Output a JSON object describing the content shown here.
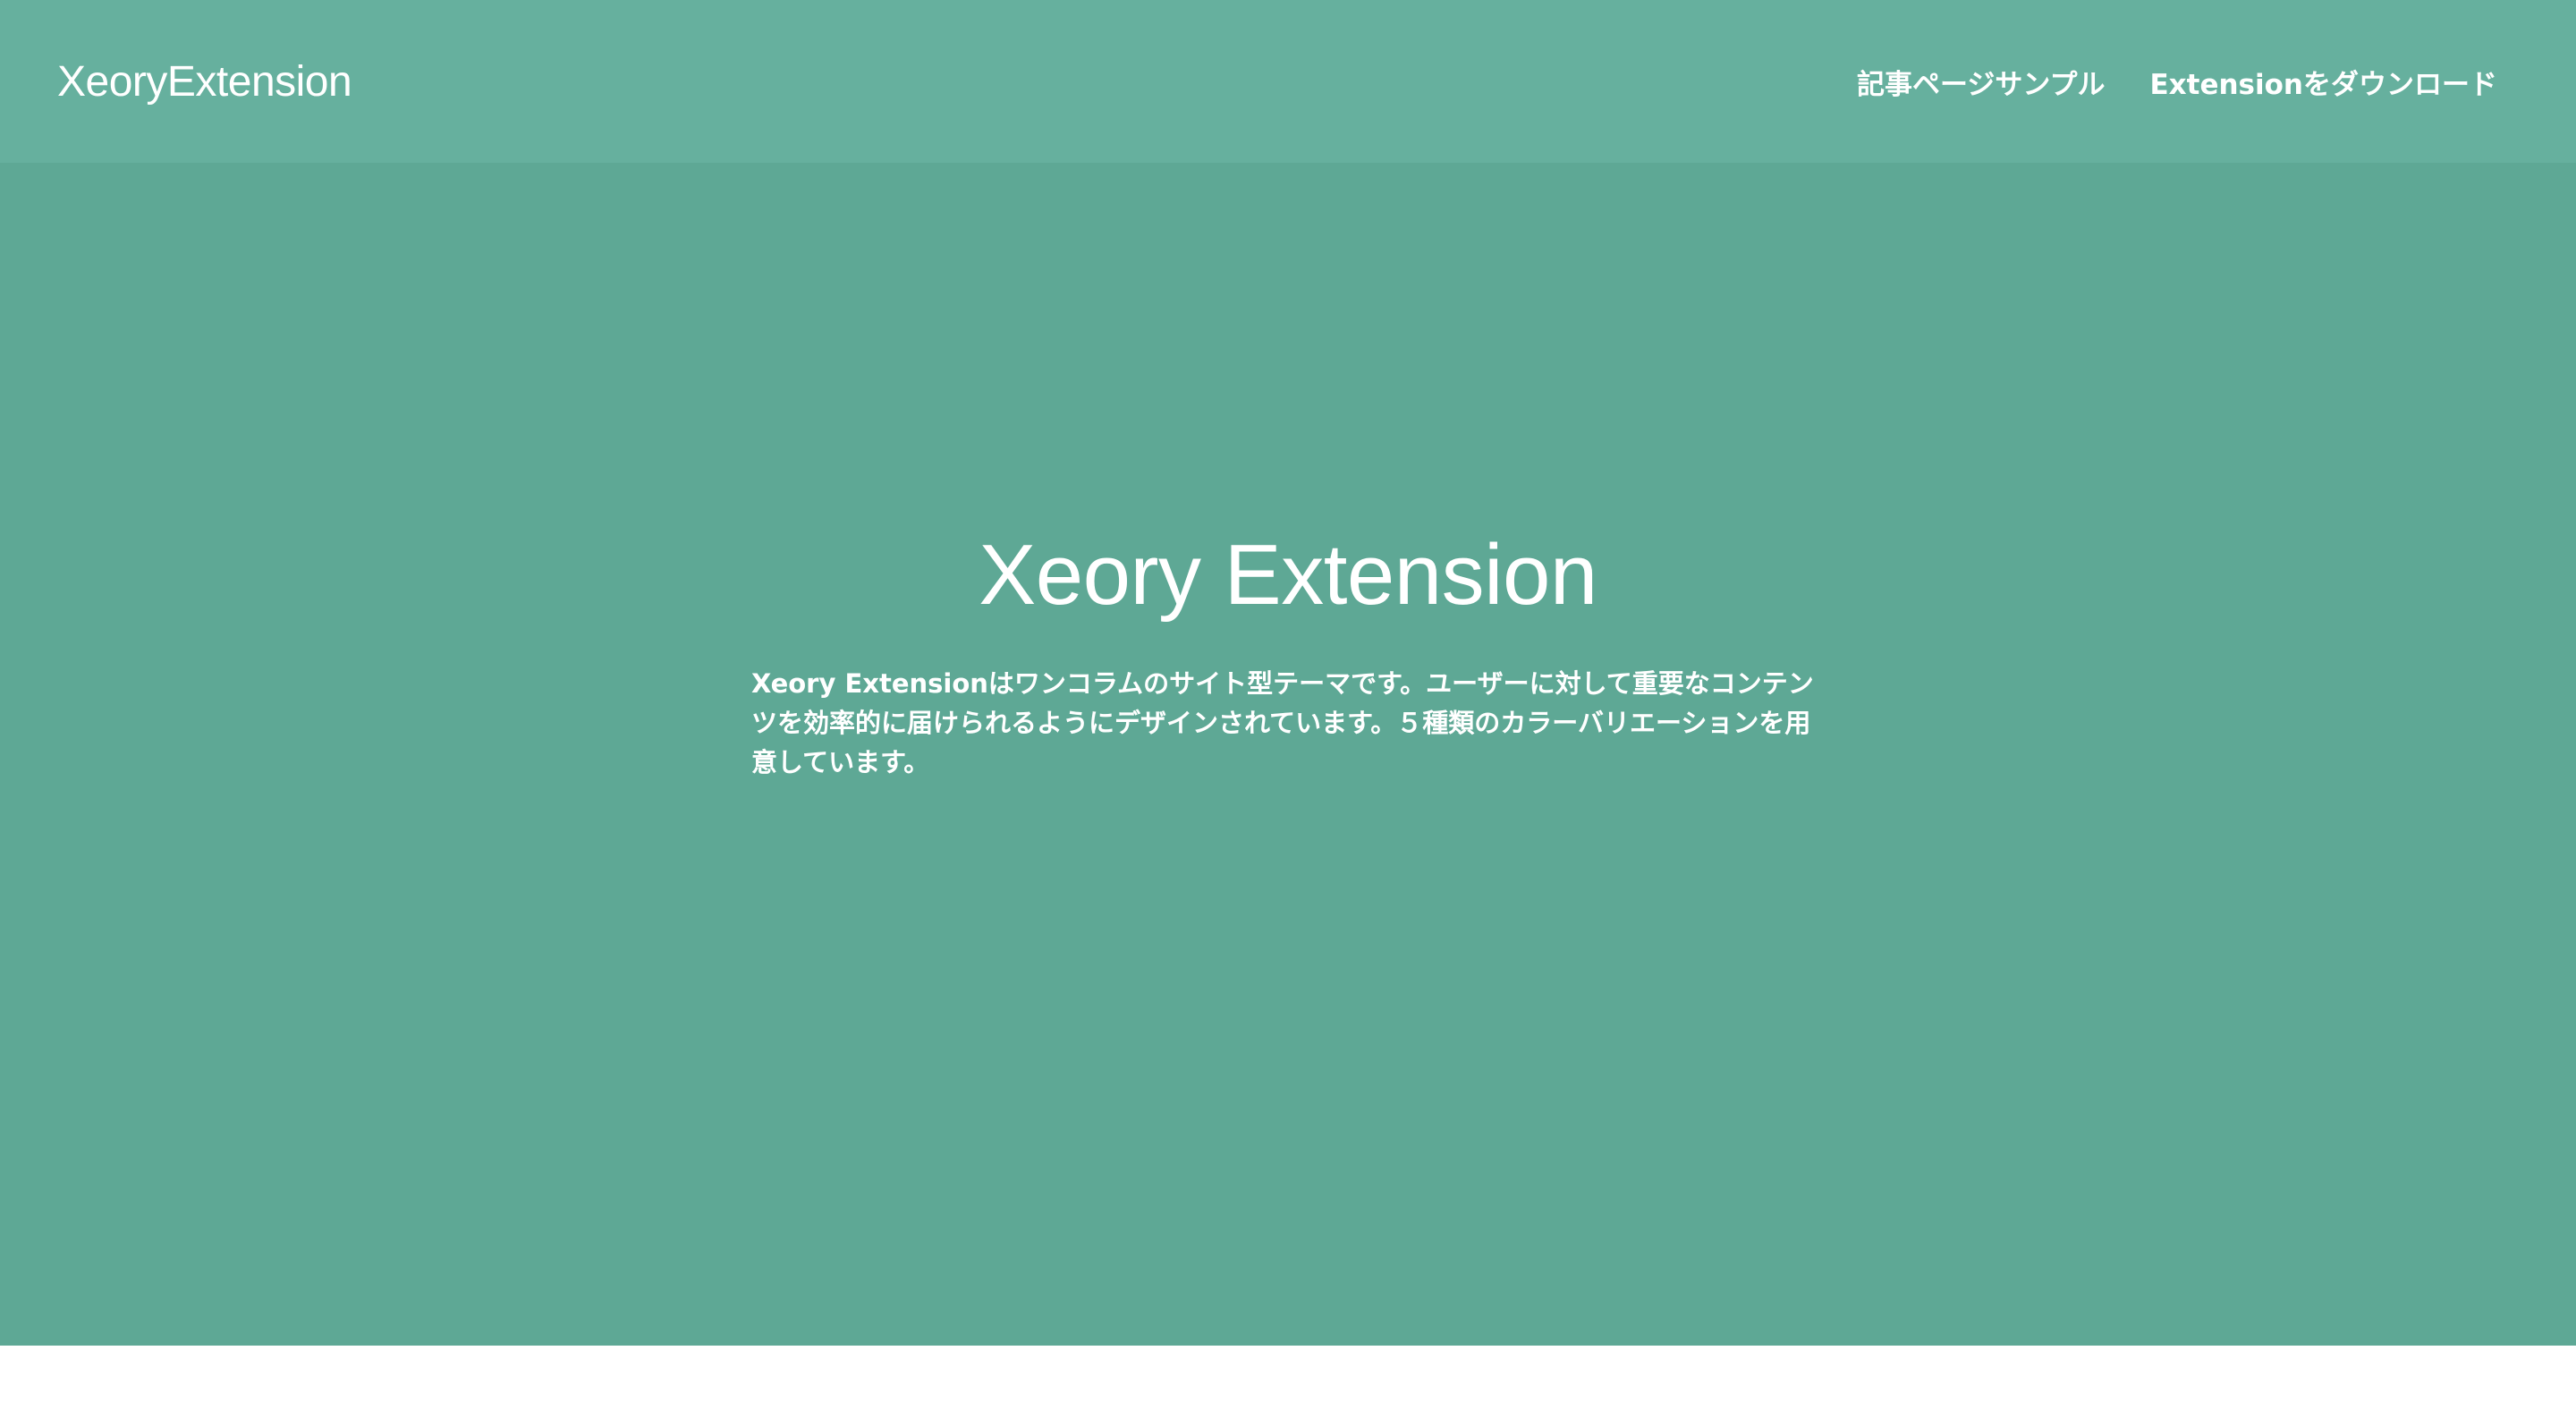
{
  "header": {
    "logo": "XeoryExtension",
    "nav": [
      {
        "label": "記事ページサンプル"
      },
      {
        "label": "Extensionをダウンロード"
      }
    ]
  },
  "hero": {
    "title": "Xeory Extension",
    "description": "Xeory Extensionはワンコラムのサイト型テーマです。ユーザーに対して重要なコンテンツを効率的に届けられるようにデザインされています。５種類のカラーバリエーションを用意しています。"
  },
  "colors": {
    "header_bg": "#66b09e",
    "hero_bg": "#5ea895",
    "text": "#ffffff"
  }
}
